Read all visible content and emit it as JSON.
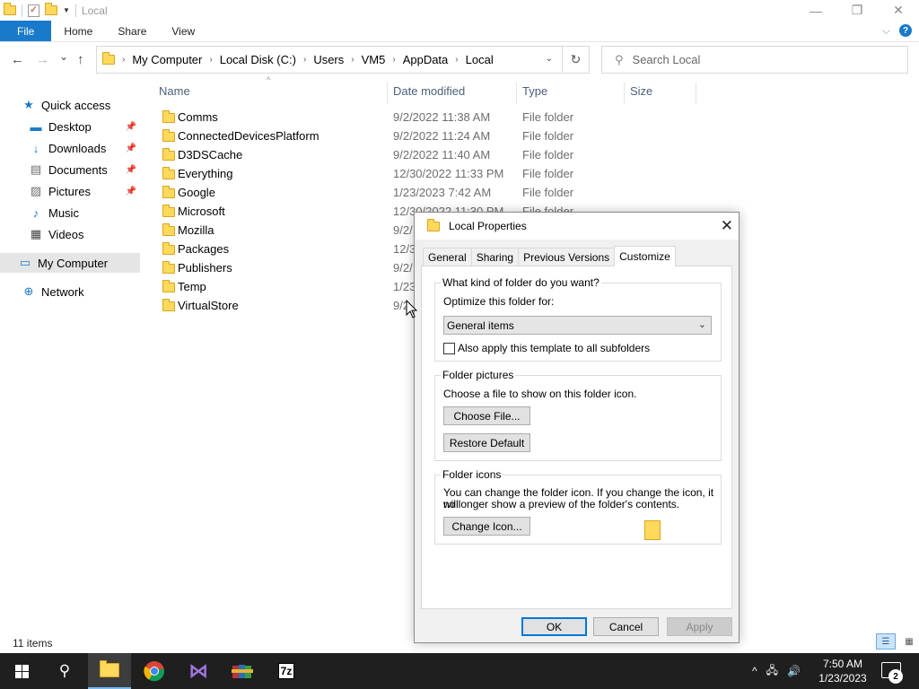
{
  "window": {
    "title": "Local",
    "minimize_glyph": "—",
    "restore_glyph": "❐",
    "close_glyph": "✕"
  },
  "ribbon": {
    "tabs": [
      "File",
      "Home",
      "Share",
      "View"
    ],
    "expand_glyph": "⌵",
    "help_glyph": "?"
  },
  "nav": {
    "back_glyph": "←",
    "forward_glyph": "→",
    "recent_glyph": "⌄",
    "up_glyph": "↑"
  },
  "address": {
    "crumbs": [
      "My Computer",
      "Local Disk (C:)",
      "Users",
      "VM5",
      "AppData",
      "Local"
    ],
    "separator": "›",
    "dropdown_glyph": "⌄",
    "refresh_glyph": "↻"
  },
  "search": {
    "placeholder": "Search Local",
    "icon_glyph": "⚲"
  },
  "sidebar": {
    "pin_glyph": "📌",
    "items": [
      {
        "label": "Quick access",
        "icon": "star-icon",
        "glyph": "★",
        "pinned": false
      },
      {
        "label": "Desktop",
        "icon": "desktop-icon",
        "glyph": "▬",
        "pinned": true
      },
      {
        "label": "Downloads",
        "icon": "download-icon",
        "glyph": "↓",
        "pinned": true
      },
      {
        "label": "Documents",
        "icon": "documents-icon",
        "glyph": "▤",
        "pinned": true
      },
      {
        "label": "Pictures",
        "icon": "pictures-icon",
        "glyph": "▨",
        "pinned": true
      },
      {
        "label": "Music",
        "icon": "music-icon",
        "glyph": "♪",
        "pinned": false
      },
      {
        "label": "Videos",
        "icon": "videos-icon",
        "glyph": "▦",
        "pinned": false
      },
      {
        "label": "My Computer",
        "icon": "computer-icon",
        "glyph": "▭",
        "pinned": false
      },
      {
        "label": "Network",
        "icon": "network-icon",
        "glyph": "⊕",
        "pinned": false
      }
    ]
  },
  "columns": {
    "name": "Name",
    "date": "Date modified",
    "type": "Type",
    "size": "Size",
    "sort_glyph": "^"
  },
  "files": [
    {
      "name": "Comms",
      "date": "9/2/2022 11:38 AM",
      "type": "File folder"
    },
    {
      "name": "ConnectedDevicesPlatform",
      "date": "9/2/2022 11:24 AM",
      "type": "File folder"
    },
    {
      "name": "D3DSCache",
      "date": "9/2/2022 11:40 AM",
      "type": "File folder"
    },
    {
      "name": "Everything",
      "date": "12/30/2022 11:33 PM",
      "type": "File folder"
    },
    {
      "name": "Google",
      "date": "1/23/2023 7:42 AM",
      "type": "File folder"
    },
    {
      "name": "Microsoft",
      "date": "12/30/2022 11:30 PM",
      "type": "File folder"
    },
    {
      "name": "Mozilla",
      "date": "9/2/",
      "type": ""
    },
    {
      "name": "Packages",
      "date": "12/3",
      "type": ""
    },
    {
      "name": "Publishers",
      "date": "9/2/",
      "type": ""
    },
    {
      "name": "Temp",
      "date": "1/23",
      "type": ""
    },
    {
      "name": "VirtualStore",
      "date": "9/2",
      "type": ""
    }
  ],
  "status": {
    "items_count": "11 items",
    "details_view_glyph": "☰",
    "tiles_view_glyph": "▦"
  },
  "dialog": {
    "title": "Local Properties",
    "close_glyph": "✕",
    "tabs": [
      "General",
      "Sharing",
      "Previous Versions",
      "Customize"
    ],
    "active_tab": "Customize",
    "kind_group": {
      "label": "What kind of folder do you want?",
      "optimize_label": "Optimize this folder for:",
      "optimize_value": "General items",
      "chevron_glyph": "⌄",
      "subfolders_label": "Also apply this template to all subfolders",
      "subfolders_checked": false
    },
    "pictures_group": {
      "label": "Folder pictures",
      "description": "Choose a file to show on this folder icon.",
      "choose_button": "Choose File...",
      "restore_button": "Restore Default"
    },
    "icons_group": {
      "label": "Folder icons",
      "description_line1": "You can change the folder icon. If you change the icon, it will",
      "description_line2": "no longer show a preview of the folder's contents.",
      "change_button": "Change Icon..."
    },
    "buttons": {
      "ok": "OK",
      "cancel": "Cancel",
      "apply": "Apply"
    }
  },
  "taskbar": {
    "search_glyph": "⚲",
    "apps": [
      "start",
      "search",
      "file-explorer",
      "chrome",
      "visual-studio",
      "winrar",
      "7zip"
    ],
    "sevenzip_label": "7z",
    "vs_glyph": "⋈",
    "tray_glyphs": {
      "chevron": "^",
      "network": "🖧",
      "volume": "🔊"
    },
    "time": "7:50 AM",
    "date": "1/23/2023",
    "notification_count": "2"
  }
}
